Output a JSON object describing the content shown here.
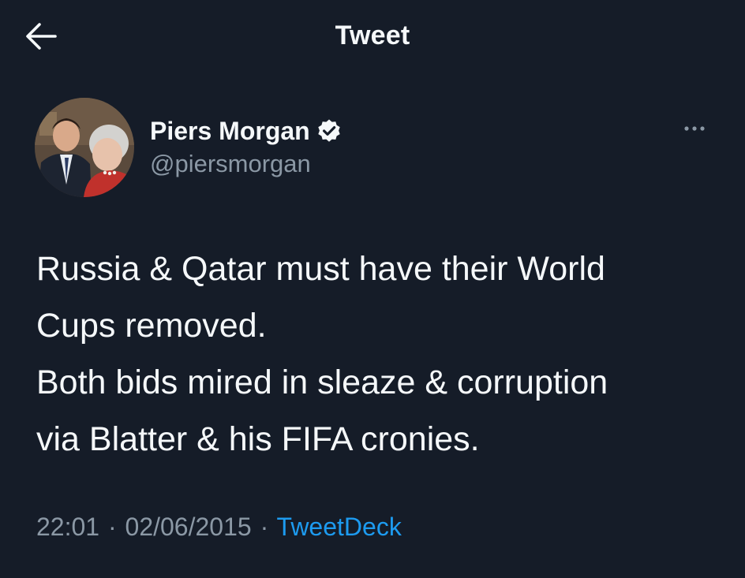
{
  "header": {
    "title": "Tweet",
    "back_icon": "arrow-left-icon"
  },
  "author": {
    "display_name": "Piers Morgan",
    "handle": "@piersmorgan",
    "verified_icon": "verified-badge-icon",
    "verified_color": "#f5f8fa"
  },
  "tweet": {
    "lines": [
      "Russia & Qatar must have their World",
      "Cups removed.",
      "Both bids mired in sleaze & corruption",
      "via Blatter & his FIFA cronies."
    ]
  },
  "meta": {
    "time": "22:01",
    "separator": "·",
    "date": "02/06/2015",
    "source": "TweetDeck"
  },
  "colors": {
    "background": "#151c28",
    "text": "#f5f8fa",
    "secondary": "#8b98a5",
    "link": "#1d9bf0"
  },
  "icons": {
    "more": "more-options-icon"
  }
}
